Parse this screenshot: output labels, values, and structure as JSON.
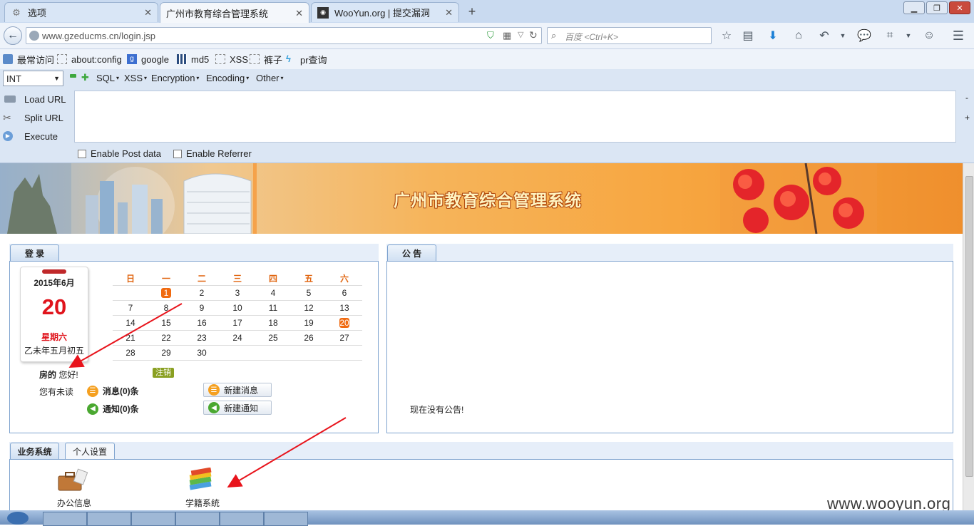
{
  "browser": {
    "tabs": [
      {
        "label": "选项",
        "icon": "gear-icon"
      },
      {
        "label": "广州市教育综合管理系统",
        "icon": "page-icon"
      },
      {
        "label": "WooYun.org | 提交漏洞",
        "icon": "wooyun-icon"
      }
    ],
    "new_tab_label": "+",
    "url": "www.gzeducms.cn/login.jsp",
    "search_placeholder": "百度 <Ctrl+K>",
    "bookmarks": [
      "最常访问",
      "about:config",
      "google",
      "md5",
      "XSS",
      "裤子",
      "pr查询"
    ]
  },
  "hackbar": {
    "select_value": "INT",
    "menus": [
      "SQL",
      "XSS",
      "Encryption",
      "Encoding",
      "Other"
    ],
    "actions": [
      "Load URL",
      "Split URL",
      "Execute"
    ],
    "checks": [
      "Enable Post data",
      "Enable Referrer"
    ]
  },
  "page": {
    "banner_title": "广州市教育综合管理系统",
    "login_tab": "登 录",
    "notice_tab": "公 告",
    "calendar": {
      "month": "2015年6月",
      "day": "20",
      "weekday": "星期六",
      "lunar": "乙未年五月初五",
      "headers": [
        "日",
        "一",
        "二",
        "三",
        "四",
        "五",
        "六"
      ],
      "rows": [
        [
          "",
          "1",
          "2",
          "3",
          "4",
          "5",
          "6"
        ],
        [
          "7",
          "8",
          "9",
          "10",
          "11",
          "12",
          "13"
        ],
        [
          "14",
          "15",
          "16",
          "17",
          "18",
          "19",
          "20"
        ],
        [
          "21",
          "22",
          "23",
          "24",
          "25",
          "26",
          "27"
        ],
        [
          "28",
          "29",
          "30",
          "",
          "",
          "",
          ""
        ]
      ],
      "highlighted": [
        "1",
        "20"
      ]
    },
    "user_name": "房的",
    "greeting": "您好!",
    "logout_label": "注销",
    "unread_label": "您有未读",
    "messages_label": "消息(0)条",
    "notices_label": "通知(0)条",
    "new_message_label": "新建消息",
    "new_notice_label": "新建通知",
    "no_notice_text": "现在没有公告!",
    "bottom_tabs": [
      "业务系统",
      "个人设置"
    ],
    "apps": [
      {
        "label": "办公信息",
        "icon": "briefcase-icon"
      },
      {
        "label": "学籍系统",
        "icon": "books-icon"
      }
    ]
  },
  "watermark": "www.wooyun.org",
  "colors": {
    "accent_orange": "#f06a10",
    "panel_border": "#7ea3cf",
    "arrow_red": "#e8141c"
  }
}
